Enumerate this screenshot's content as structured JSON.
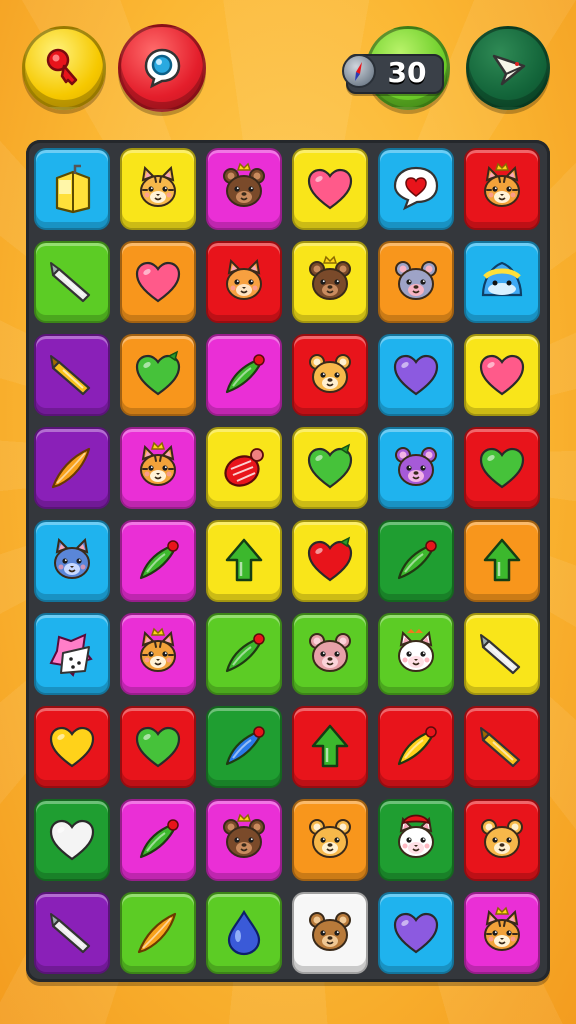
{
  "header": {
    "left_buttons": [
      {
        "id": "btn-key",
        "icon": "key-icon"
      },
      {
        "id": "btn-target",
        "icon": "target-bubble-icon"
      }
    ],
    "counter": {
      "value": "30",
      "icon": "compass-icon"
    },
    "right_button": {
      "id": "btn-exit",
      "icon": "plane-exit-icon"
    }
  },
  "palette": {
    "blue": "#1fb3ee",
    "yellow": "#f9e51a",
    "magenta": "#ea2fd6",
    "red": "#e8141b",
    "green": "#5ccc25",
    "orange": "#f8961c",
    "purple": "#8a20b8",
    "darkgreen": "#1f9e31",
    "white": "#f7f7f7"
  },
  "board": {
    "columns": 6,
    "rows": [
      [
        {
          "bg": "blue",
          "icon": "juice-box-icon"
        },
        {
          "bg": "yellow",
          "icon": "tiger-cat-icon"
        },
        {
          "bg": "magenta",
          "icon": "brown-bear-crown-icon"
        },
        {
          "bg": "yellow",
          "icon": "pink-heart-icon"
        },
        {
          "bg": "blue",
          "icon": "heart-bubble-icon"
        },
        {
          "bg": "red",
          "icon": "tiger-crown-icon"
        }
      ],
      [
        {
          "bg": "green",
          "icon": "crayon-white-icon"
        },
        {
          "bg": "orange",
          "icon": "pink-heart-icon"
        },
        {
          "bg": "red",
          "icon": "orange-cat-icon"
        },
        {
          "bg": "yellow",
          "icon": "brown-bear-crown-icon"
        },
        {
          "bg": "orange",
          "icon": "grey-mouse-icon"
        },
        {
          "bg": "blue",
          "icon": "blue-slime-icon"
        }
      ],
      [
        {
          "bg": "purple",
          "icon": "crayon-yellow-icon"
        },
        {
          "bg": "orange",
          "icon": "green-leaf-heart-icon"
        },
        {
          "bg": "magenta",
          "icon": "green-chili-icon"
        },
        {
          "bg": "red",
          "icon": "orange-hamster-icon"
        },
        {
          "bg": "blue",
          "icon": "purple-heart-icon"
        },
        {
          "bg": "yellow",
          "icon": "pink-heart-icon"
        }
      ],
      [
        {
          "bg": "purple",
          "icon": "orange-feather-icon"
        },
        {
          "bg": "magenta",
          "icon": "tiger-crown-icon"
        },
        {
          "bg": "yellow",
          "icon": "red-berry-icon"
        },
        {
          "bg": "yellow",
          "icon": "green-leaf-heart-icon"
        },
        {
          "bg": "blue",
          "icon": "purple-mouse-icon"
        },
        {
          "bg": "red",
          "icon": "green-heart-icon"
        }
      ],
      [
        {
          "bg": "blue",
          "icon": "blue-cat-icon"
        },
        {
          "bg": "magenta",
          "icon": "green-chili-icon"
        },
        {
          "bg": "yellow",
          "icon": "green-arrow-up-icon"
        },
        {
          "bg": "yellow",
          "icon": "red-leaf-heart-icon"
        },
        {
          "bg": "darkgreen",
          "icon": "green-chili-icon"
        },
        {
          "bg": "orange",
          "icon": "green-arrow-up-icon"
        }
      ],
      [
        {
          "bg": "blue",
          "icon": "star-dice-icon"
        },
        {
          "bg": "magenta",
          "icon": "tiger-crown-icon"
        },
        {
          "bg": "green",
          "icon": "green-chili-icon"
        },
        {
          "bg": "green",
          "icon": "pink-mouse-icon"
        },
        {
          "bg": "green",
          "icon": "white-cat-icon"
        },
        {
          "bg": "yellow",
          "icon": "crayon-white-icon"
        }
      ],
      [
        {
          "bg": "red",
          "icon": "yellow-heart-icon"
        },
        {
          "bg": "red",
          "icon": "green-heart-icon"
        },
        {
          "bg": "darkgreen",
          "icon": "blue-chili-icon"
        },
        {
          "bg": "red",
          "icon": "green-arrow-up-icon"
        },
        {
          "bg": "red",
          "icon": "yellow-chili-icon"
        },
        {
          "bg": "red",
          "icon": "crayon-yellow-icon"
        }
      ],
      [
        {
          "bg": "darkgreen",
          "icon": "white-heart-icon"
        },
        {
          "bg": "magenta",
          "icon": "green-chili-icon"
        },
        {
          "bg": "magenta",
          "icon": "brown-bear-crown-icon"
        },
        {
          "bg": "orange",
          "icon": "orange-hamster-icon"
        },
        {
          "bg": "darkgreen",
          "icon": "white-cat-red-hat-icon"
        },
        {
          "bg": "red",
          "icon": "orange-hamster-icon"
        }
      ],
      [
        {
          "bg": "purple",
          "icon": "crayon-white-icon"
        },
        {
          "bg": "green",
          "icon": "orange-feather-icon"
        },
        {
          "bg": "green",
          "icon": "blue-drop-icon"
        },
        {
          "bg": "white",
          "icon": "brown-bear-icon"
        },
        {
          "bg": "blue",
          "icon": "purple-heart-icon"
        },
        {
          "bg": "magenta",
          "icon": "tiger-crown-icon"
        }
      ]
    ]
  }
}
